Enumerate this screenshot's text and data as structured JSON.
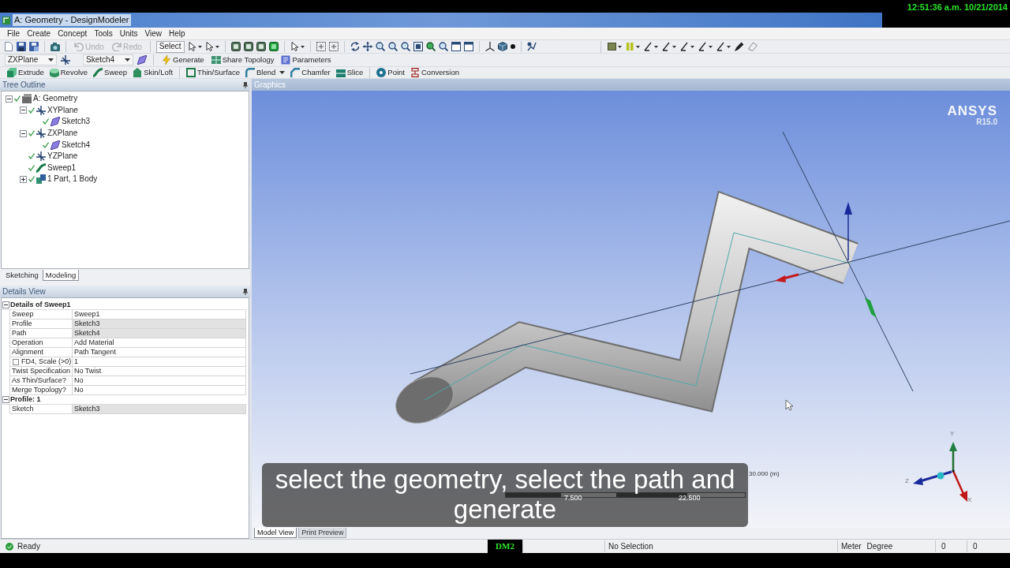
{
  "window": {
    "title": "A: Geometry - DesignModeler",
    "clock": "12:51:36 a.m. 10/21/2014"
  },
  "menu": [
    "File",
    "Create",
    "Concept",
    "Tools",
    "Units",
    "View",
    "Help"
  ],
  "toolbar": {
    "undo": {
      "label": "Undo",
      "disabled": true
    },
    "redo": {
      "label": "Redo",
      "disabled": true
    },
    "select": {
      "label": "Select"
    }
  },
  "sketch_toolbar": {
    "plane": "ZXPlane",
    "sketch": "Sketch4",
    "actions": [
      {
        "label": "Generate"
      },
      {
        "label": "Share Topology"
      },
      {
        "label": "Parameters"
      }
    ]
  },
  "modeling_toolbar": {
    "groups": [
      {
        "items": [
          {
            "label": "Extrude",
            "dropdown": false
          },
          {
            "label": "Revolve",
            "dropdown": false
          },
          {
            "label": "Sweep",
            "dropdown": false
          },
          {
            "label": "Skin/Loft",
            "dropdown": false
          }
        ]
      },
      {
        "items": [
          {
            "label": "Thin/Surface",
            "dropdown": false
          },
          {
            "label": "Blend",
            "dropdown": true
          },
          {
            "label": "Chamfer",
            "dropdown": false
          },
          {
            "label": "Slice",
            "dropdown": false
          }
        ]
      },
      {
        "items": [
          {
            "label": "Point",
            "dropdown": false
          },
          {
            "label": "Conversion",
            "dropdown": false
          }
        ]
      }
    ]
  },
  "tree_outline": {
    "title": "Tree Outline",
    "items": [
      {
        "label": "A: Geometry",
        "kind": "geometry",
        "expanded": true,
        "children": [
          {
            "label": "XYPlane",
            "kind": "plane",
            "expanded": true,
            "children": [
              {
                "label": "Sketch3",
                "kind": "sketch"
              }
            ]
          },
          {
            "label": "ZXPlane",
            "kind": "plane",
            "expanded": true,
            "children": [
              {
                "label": "Sketch4",
                "kind": "sketch"
              }
            ]
          },
          {
            "label": "YZPlane",
            "kind": "plane"
          },
          {
            "label": "Sweep1",
            "kind": "sweep"
          },
          {
            "label": "1 Part, 1 Body",
            "kind": "body",
            "expanded": false
          }
        ]
      }
    ]
  },
  "panel_tabs": [
    {
      "label": "Sketching",
      "selected": false
    },
    {
      "label": "Modeling",
      "selected": true
    }
  ],
  "details_view": {
    "title": "Details View",
    "sections": [
      {
        "title": "Details of Sweep1",
        "expanded": true,
        "rows": [
          {
            "kind": "field",
            "name": "Sweep",
            "value": "Sweep1",
            "shaded": false
          },
          {
            "kind": "field",
            "name": "Profile",
            "value": "Sketch3",
            "shaded": true
          },
          {
            "kind": "field",
            "name": "Path",
            "value": "Sketch4",
            "shaded": true
          },
          {
            "kind": "field",
            "name": "Operation",
            "value": "Add Material",
            "shaded": false
          },
          {
            "kind": "field",
            "name": "Alignment",
            "value": "Path Tangent",
            "shaded": false
          },
          {
            "kind": "parameter",
            "name": "FD4, Scale (>0)",
            "value": "1",
            "shaded": false,
            "checked": false
          },
          {
            "kind": "field",
            "name": "Twist Specification",
            "value": "No Twist",
            "shaded": false
          },
          {
            "kind": "field",
            "name": "As Thin/Surface?",
            "value": "No",
            "shaded": false
          },
          {
            "kind": "field",
            "name": "Merge Topology?",
            "value": "No",
            "shaded": false
          }
        ]
      },
      {
        "title": "Profile: 1",
        "expanded": true,
        "rows": [
          {
            "kind": "field",
            "name": "Sketch",
            "value": "Sketch3",
            "shaded": true
          }
        ]
      }
    ]
  },
  "graphics": {
    "title": "Graphics",
    "logo": "ANSYS",
    "version": "R15.0",
    "scale": {
      "end_label": "30.000 (m)",
      "tick_labels": [
        "7.500",
        "22.500"
      ]
    },
    "triad_labels": [
      "Y",
      "Z",
      "X"
    ],
    "view_tabs": [
      {
        "label": "Model View",
        "selected": true
      },
      {
        "label": "Print Preview",
        "selected": false
      }
    ]
  },
  "caption": "select the geometry, select the path and generate",
  "status_bar": {
    "message": "Ready",
    "mode": "DM2",
    "selection": "No Selection",
    "length_unit": "Meter",
    "angle_unit": "Degree",
    "fields": [
      "0",
      "0"
    ]
  }
}
